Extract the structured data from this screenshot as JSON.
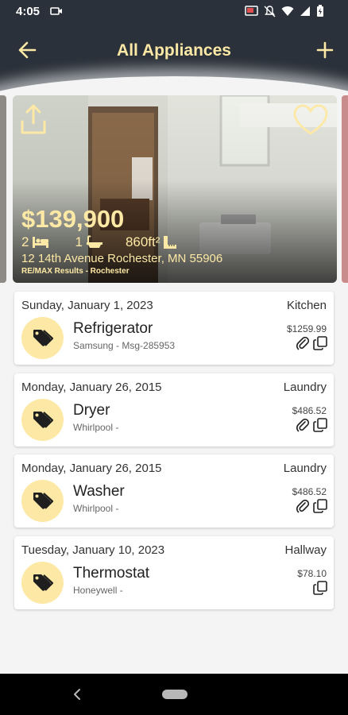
{
  "status_bar": {
    "time": "4:05"
  },
  "header": {
    "title": "All Appliances"
  },
  "property": {
    "price": "$139,900",
    "beds": "2",
    "baths": "1",
    "area": "860ft²",
    "address": "12 14th Avenue Rochester, MN 55906",
    "broker": "RE/MAX Results - Rochester"
  },
  "appliances": [
    {
      "date": "Sunday, January 1, 2023",
      "room": "Kitchen",
      "name": "Refrigerator",
      "sub": "Samsung - Msg-285953",
      "price": "$1259.99",
      "has_attachment": true
    },
    {
      "date": "Monday, January 26, 2015",
      "room": "Laundry",
      "name": "Dryer",
      "sub": "Whirlpool -",
      "price": "$486.52",
      "has_attachment": true
    },
    {
      "date": "Monday, January 26, 2015",
      "room": "Laundry",
      "name": "Washer",
      "sub": "Whirlpool -",
      "price": "$486.52",
      "has_attachment": true
    },
    {
      "date": "Tuesday, January 10, 2023",
      "room": "Hallway",
      "name": "Thermostat",
      "sub": "Honeywell -",
      "price": "$78.10",
      "has_attachment": false
    }
  ],
  "colors": {
    "accent": "#fde9a5",
    "app_bar": "#2b313a",
    "background": "#f4f4f4"
  },
  "icons": [
    "back-arrow-icon",
    "add-icon",
    "share-icon",
    "heart-icon",
    "bed-icon",
    "bath-icon",
    "area-icon",
    "tag-icon",
    "paperclip-icon",
    "copy-icon"
  ]
}
